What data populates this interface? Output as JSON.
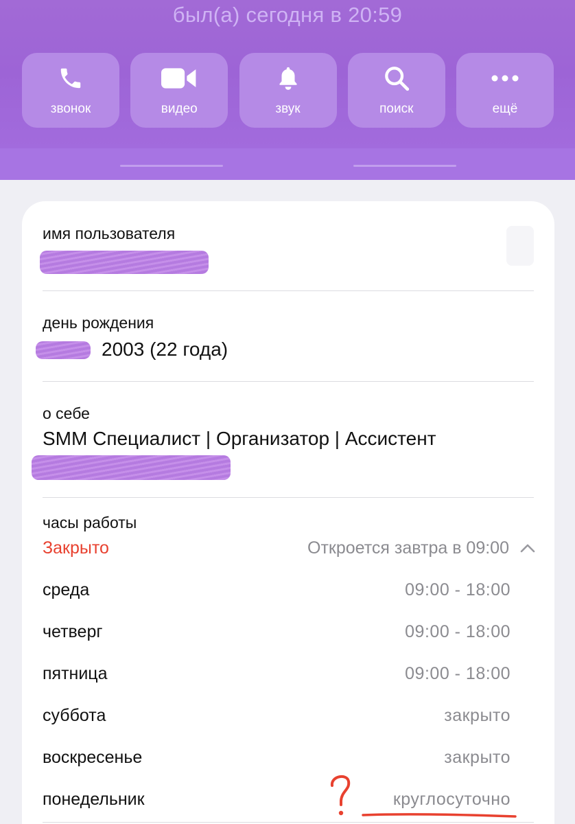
{
  "header": {
    "last_seen": "был(а) сегодня в 20:59",
    "actions": [
      {
        "label": "звонок",
        "icon": "phone-icon"
      },
      {
        "label": "видео",
        "icon": "video-camera-icon"
      },
      {
        "label": "звук",
        "icon": "bell-icon"
      },
      {
        "label": "поиск",
        "icon": "search-icon"
      },
      {
        "label": "ещё",
        "icon": "more-dots-icon"
      }
    ]
  },
  "profile": {
    "username_label": "имя пользователя",
    "birthday_label": "день рождения",
    "birthday_value": "2003 (22 года)",
    "bio_label": "о себе",
    "bio_value": "SMM Специалист | Организатор | Ассистент"
  },
  "hours": {
    "label": "часы работы",
    "status": "Закрыто",
    "next_open": "Откроется завтра в 09:00",
    "days": [
      {
        "day": "среда",
        "hours": "09:00 - 18:00"
      },
      {
        "day": "четверг",
        "hours": "09:00 - 18:00"
      },
      {
        "day": "пятница",
        "hours": "09:00 - 18:00"
      },
      {
        "day": "суббота",
        "hours": "закрыто"
      },
      {
        "day": "воскресенье",
        "hours": "закрыто"
      },
      {
        "day": "понедельник",
        "hours": "круглосуточно"
      }
    ]
  },
  "annotation": {
    "mark": "?"
  },
  "colors": {
    "accent": "#9d64d6",
    "status_closed": "#e8412f",
    "annotation": "#e8412f"
  }
}
